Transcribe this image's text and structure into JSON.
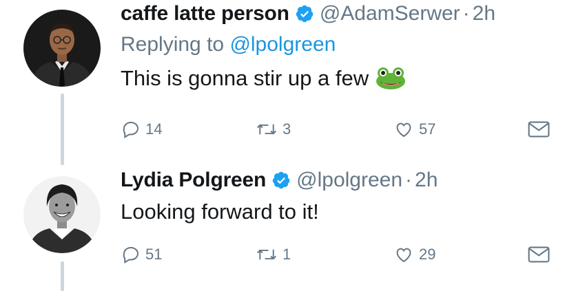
{
  "tweets": [
    {
      "name": "caffe latte person",
      "handle": "@AdamSerwer",
      "separator": "·",
      "time": "2h",
      "replying_prefix": "Replying to",
      "replying_to": "@lpolgreen",
      "text": "This is gonna stir up a few",
      "emoji": "frog-emoji",
      "replies": "14",
      "retweets": "3",
      "likes": "57"
    },
    {
      "name": "Lydia Polgreen",
      "handle": "@lpolgreen",
      "separator": "·",
      "time": "2h",
      "text": "Looking forward to it!",
      "replies": "51",
      "retweets": "1",
      "likes": "29"
    }
  ],
  "colors": {
    "text": "#14171a",
    "secondary": "#657786",
    "link": "#1b95e0",
    "verified": "#1da1f2",
    "thread_line": "#ccd6dd"
  },
  "icons": [
    "reply-icon",
    "retweet-icon",
    "like-icon",
    "dm-icon",
    "verified-badge-icon"
  ]
}
